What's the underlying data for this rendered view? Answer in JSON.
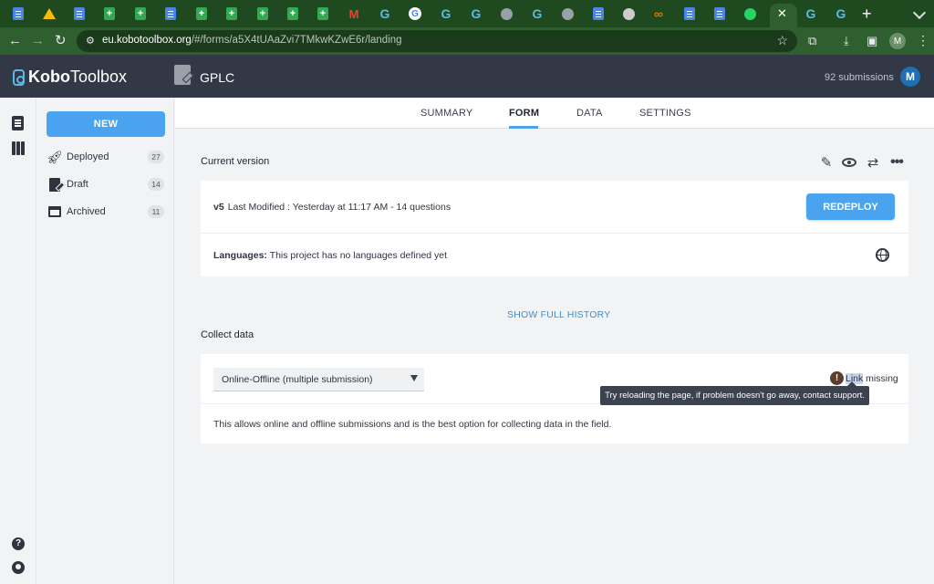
{
  "browser": {
    "tabs": [
      {
        "icon": "docs-icon"
      },
      {
        "icon": "drive-icon"
      },
      {
        "icon": "docs-icon"
      },
      {
        "icon": "sheets-icon"
      },
      {
        "icon": "sheets-icon"
      },
      {
        "icon": "docs-icon"
      },
      {
        "icon": "sheets-icon"
      },
      {
        "icon": "sheets-icon"
      },
      {
        "icon": "sheets-icon"
      },
      {
        "icon": "sheets-icon"
      },
      {
        "icon": "gmail-icon"
      },
      {
        "icon": "kobo-icon"
      },
      {
        "icon": "google-icon"
      },
      {
        "icon": "kobo-icon"
      },
      {
        "icon": "kobo-icon"
      },
      {
        "icon": "globe-icon"
      },
      {
        "icon": "kobo-icon"
      },
      {
        "icon": "globe-icon"
      },
      {
        "icon": "docs-icon"
      },
      {
        "icon": "chatgpt-icon"
      },
      {
        "icon": "infinity-icon"
      },
      {
        "icon": "docs-icon"
      },
      {
        "icon": "docs-icon"
      },
      {
        "icon": "whatsapp-icon"
      }
    ],
    "active_tab_close": "✕",
    "new_tab_label": "+",
    "url_host": "eu.kobotoolbox.org",
    "url_path": "/#/forms/a5X4tUAaZvi7TMkwKZwE6r/landing",
    "profile_initial": "M"
  },
  "header": {
    "logo_part1": "Kobo",
    "logo_part2": "Toolbox",
    "form_title": "GPLC",
    "submissions": "92 submissions",
    "avatar_initial": "M"
  },
  "sidebar": {
    "new_label": "NEW",
    "items": [
      {
        "label": "Deployed",
        "count": "27",
        "icon": "rocket-icon"
      },
      {
        "label": "Draft",
        "count": "14",
        "icon": "draft-icon"
      },
      {
        "label": "Archived",
        "count": "11",
        "icon": "archive-icon"
      }
    ]
  },
  "tabs": [
    {
      "label": "SUMMARY"
    },
    {
      "label": "FORM"
    },
    {
      "label": "DATA"
    },
    {
      "label": "SETTINGS"
    }
  ],
  "form": {
    "current_version_label": "Current version",
    "version": "v5",
    "version_meta": "Last Modified : Yesterday at 11:17 AM - 14 questions",
    "redeploy_label": "REDEPLOY",
    "languages_label": "Languages:",
    "languages_text": "This project has no languages defined yet",
    "show_history": "SHOW FULL HISTORY",
    "collect_label": "Collect data",
    "collect_method": "Online-Offline (multiple submission)",
    "link_word": "Link",
    "link_rest": " missing",
    "tooltip": "Try reloading the page, if problem doesn't go away, contact support.",
    "description": "This allows online and offline submissions and is the best option for collecting data in the field."
  },
  "colors": {
    "accent": "#4aa3ee",
    "header_bg": "#333846",
    "browser_green": "#2f5e2f"
  }
}
